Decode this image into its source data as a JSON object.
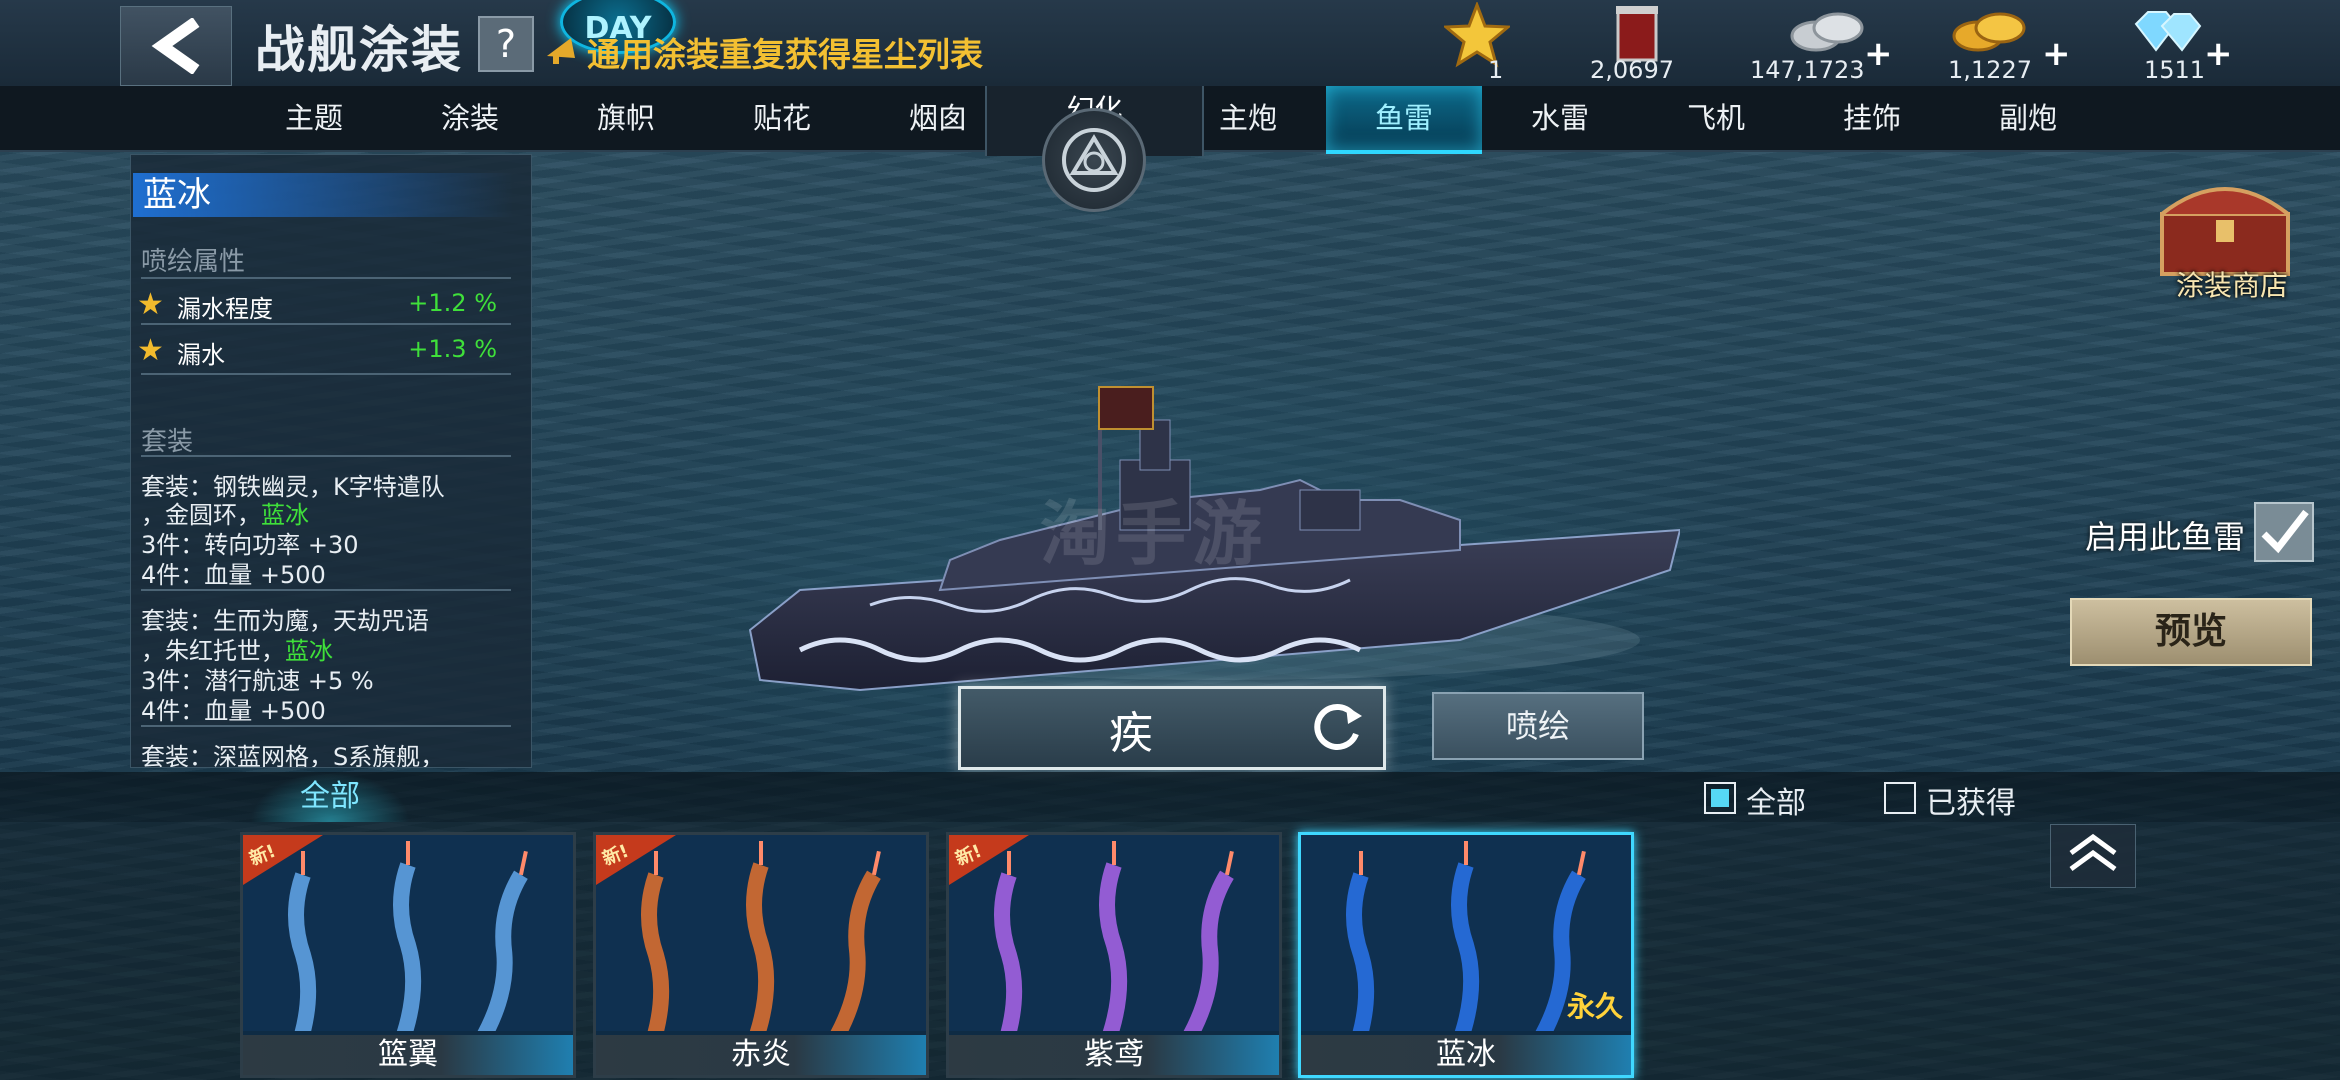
{
  "header": {
    "title": "战舰涂装",
    "help_label": "?",
    "event_badge": "DAY",
    "stardust_link": "通用涂装重复获得星尘列表"
  },
  "resources": [
    {
      "name": "star-icon",
      "value": "1",
      "has_plus": false
    },
    {
      "name": "paint-bucket-icon",
      "value": "2,0697",
      "has_plus": false
    },
    {
      "name": "silver-coins-icon",
      "value": "147,1723",
      "has_plus": true
    },
    {
      "name": "gold-coins-icon",
      "value": "1,1227",
      "has_plus": true
    },
    {
      "name": "diamond-icon",
      "value": "1511",
      "has_plus": true
    }
  ],
  "tabs_left": [
    "主题",
    "涂装",
    "旗帜",
    "贴花",
    "烟囱"
  ],
  "huanhua": "幻化",
  "tabs_right": [
    "主炮",
    "鱼雷",
    "水雷",
    "飞机",
    "挂饰",
    "副炮"
  ],
  "active_tab": "鱼雷",
  "panel": {
    "skin_name": "蓝冰",
    "spray_attr_title": "喷绘属性",
    "attrs": [
      {
        "name": "漏水程度",
        "value": "+1.2 %"
      },
      {
        "name": "漏水",
        "value": "+1.3 %"
      }
    ],
    "set_title": "套装",
    "set1_line1": "套装：钢铁幽灵，K字特遣队",
    "set1_line2a": "，金圆环，",
    "set1_line2b": "蓝冰",
    "set1_b3": "3件：转向功率 +30",
    "set1_b4": "4件：血量 +500",
    "set2_line1": "套装：生而为魔，天劫咒语",
    "set2_line2a": "，朱红托世，",
    "set2_line2b": "蓝冰",
    "set2_b3": "3件：潜行航速 +5 %",
    "set2_b4": "4件：血量 +500",
    "set3_line1": "套装：深蓝网格，S系旗舰，"
  },
  "center": {
    "mode_text": "疾",
    "spray_button": "喷绘",
    "watermark": "淘手游"
  },
  "right": {
    "shop_label": "涂装商店",
    "enable_label": "启用此鱼雷",
    "enable_checked": true,
    "preview_button": "预览"
  },
  "filter": {
    "tab_label": "全部",
    "cb_all_label": "全部",
    "cb_all_checked": true,
    "cb_obtained_label": "已获得",
    "cb_obtained_checked": false
  },
  "cards": [
    {
      "name": "篮翼",
      "color": "#6fb7ff",
      "new": true,
      "new_label": "新!",
      "perm": ""
    },
    {
      "name": "赤炎",
      "color": "#ff7a2a",
      "new": true,
      "new_label": "新!",
      "perm": ""
    },
    {
      "name": "紫鸢",
      "color": "#c06bff",
      "new": true,
      "new_label": "新!",
      "perm": ""
    },
    {
      "name": "蓝冰",
      "color": "#2d7cff",
      "new": false,
      "new_label": "",
      "perm": "永久"
    }
  ]
}
